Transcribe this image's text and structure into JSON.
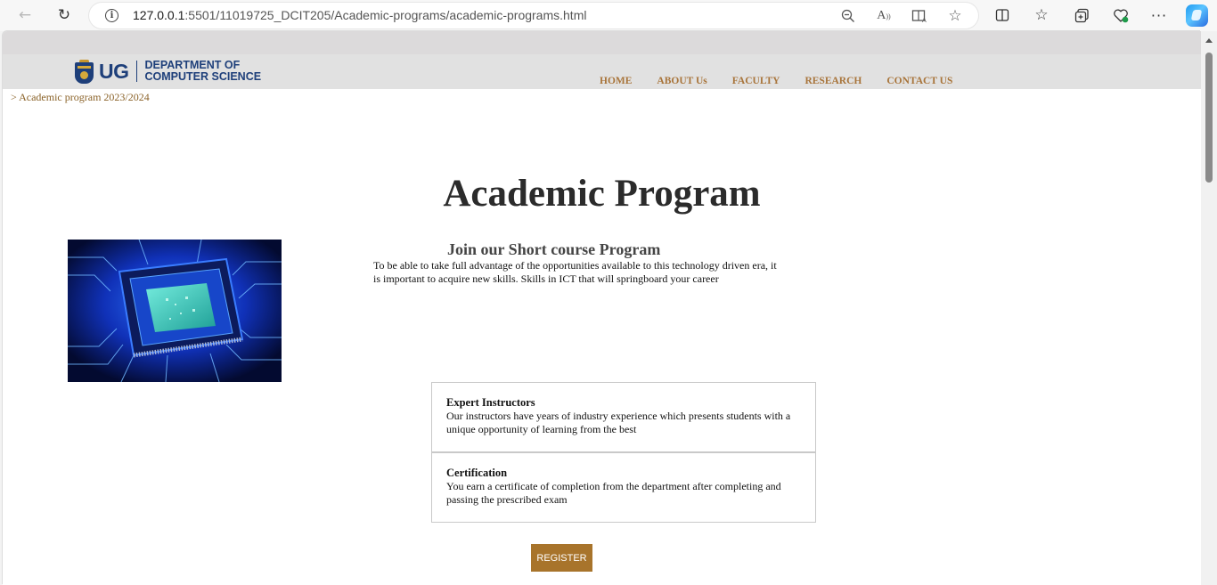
{
  "browser": {
    "url_host": "127.0.0.1",
    "url_path": ":5501/11019725_DCIT205/Academic-programs/academic-programs.html"
  },
  "site": {
    "logo": {
      "short": "UG",
      "line1": "DEPARTMENT OF",
      "line2": "COMPUTER SCIENCE"
    },
    "nav": [
      "HOME",
      "ABOUT Us",
      "FACULTY",
      "RESEARCH",
      "CONTACT US"
    ]
  },
  "breadcrumb": "> Academic program 2023/2024",
  "main": {
    "title": "Academic Program",
    "intro_heading": "Join our Short course Program",
    "intro_text": "To be able to take full advantage of the opportunities available to this technology driven era, it is important to acquire new skills. Skills in ICT that will springboard your career",
    "features": [
      {
        "title": "Expert Instructors",
        "text": "Our instructors have years of industry experience which presents students with a unique opportunity of learning from the best"
      },
      {
        "title": "Certification",
        "text": "You earn a certificate of completion from the department after completing and passing the prescribed exam"
      }
    ],
    "register_label": "REGISTER"
  },
  "colors": {
    "nav_text": "#a8743a",
    "register_bg": "#a8742b",
    "brand_blue": "#1e3f7a"
  },
  "icons": [
    "back-arrow-icon",
    "refresh-icon",
    "info-icon",
    "zoom-out-icon",
    "read-aloud-icon",
    "immersive-reader-icon",
    "favorite-star-icon",
    "split-screen-icon",
    "favorites-icon",
    "collections-icon",
    "browser-essentials-icon",
    "more-menu-icon",
    "copilot-icon"
  ]
}
